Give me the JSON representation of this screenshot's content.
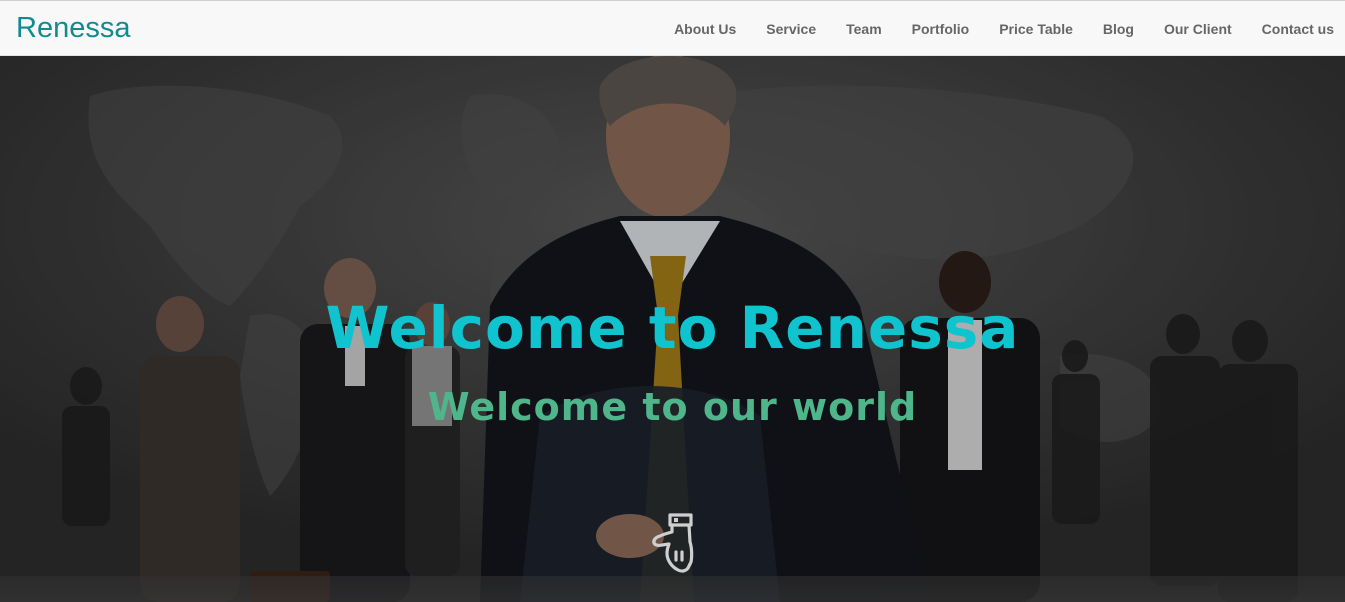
{
  "brand": {
    "name": "Renessa"
  },
  "nav": {
    "items": [
      {
        "label": "About Us"
      },
      {
        "label": "Service"
      },
      {
        "label": "Team"
      },
      {
        "label": "Portfolio"
      },
      {
        "label": "Price Table"
      },
      {
        "label": "Blog"
      },
      {
        "label": "Our Client"
      },
      {
        "label": "Contact us"
      }
    ]
  },
  "hero": {
    "title": "Welcome to Renessa",
    "subtitle": "Welcome to our world",
    "scroll_icon": "hand-pointing-down-icon"
  },
  "colors": {
    "brand": "#128a8f",
    "nav_text": "#666666",
    "hero_title": "#10c4cf",
    "hero_subtitle": "#4fb58a",
    "navbar_bg": "#f8f8f8"
  }
}
